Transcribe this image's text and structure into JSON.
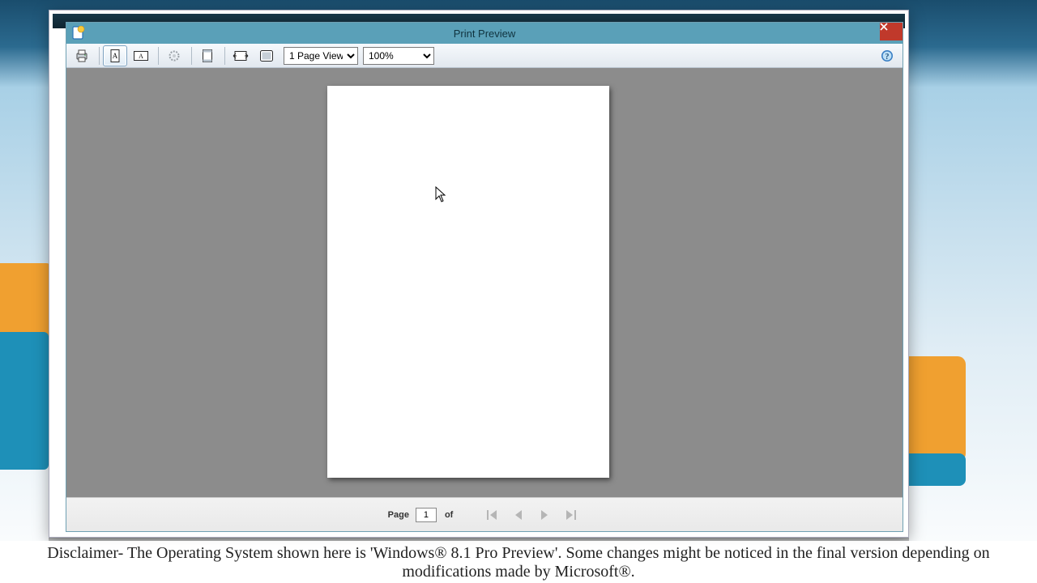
{
  "window": {
    "title": "Print Preview"
  },
  "toolbar": {
    "view_options": [
      "1 Page View"
    ],
    "view_selected": "1 Page View",
    "zoom_options": [
      "100%"
    ],
    "zoom_selected": "100%"
  },
  "nav": {
    "page_label": "Page",
    "page_value": "1",
    "of_label": "of"
  },
  "disclaimer": "Disclaimer- The Operating System shown here is 'Windows® 8.1 Pro Preview'. Some changes might be noticed in the final version depending on modifications made by Microsoft®."
}
